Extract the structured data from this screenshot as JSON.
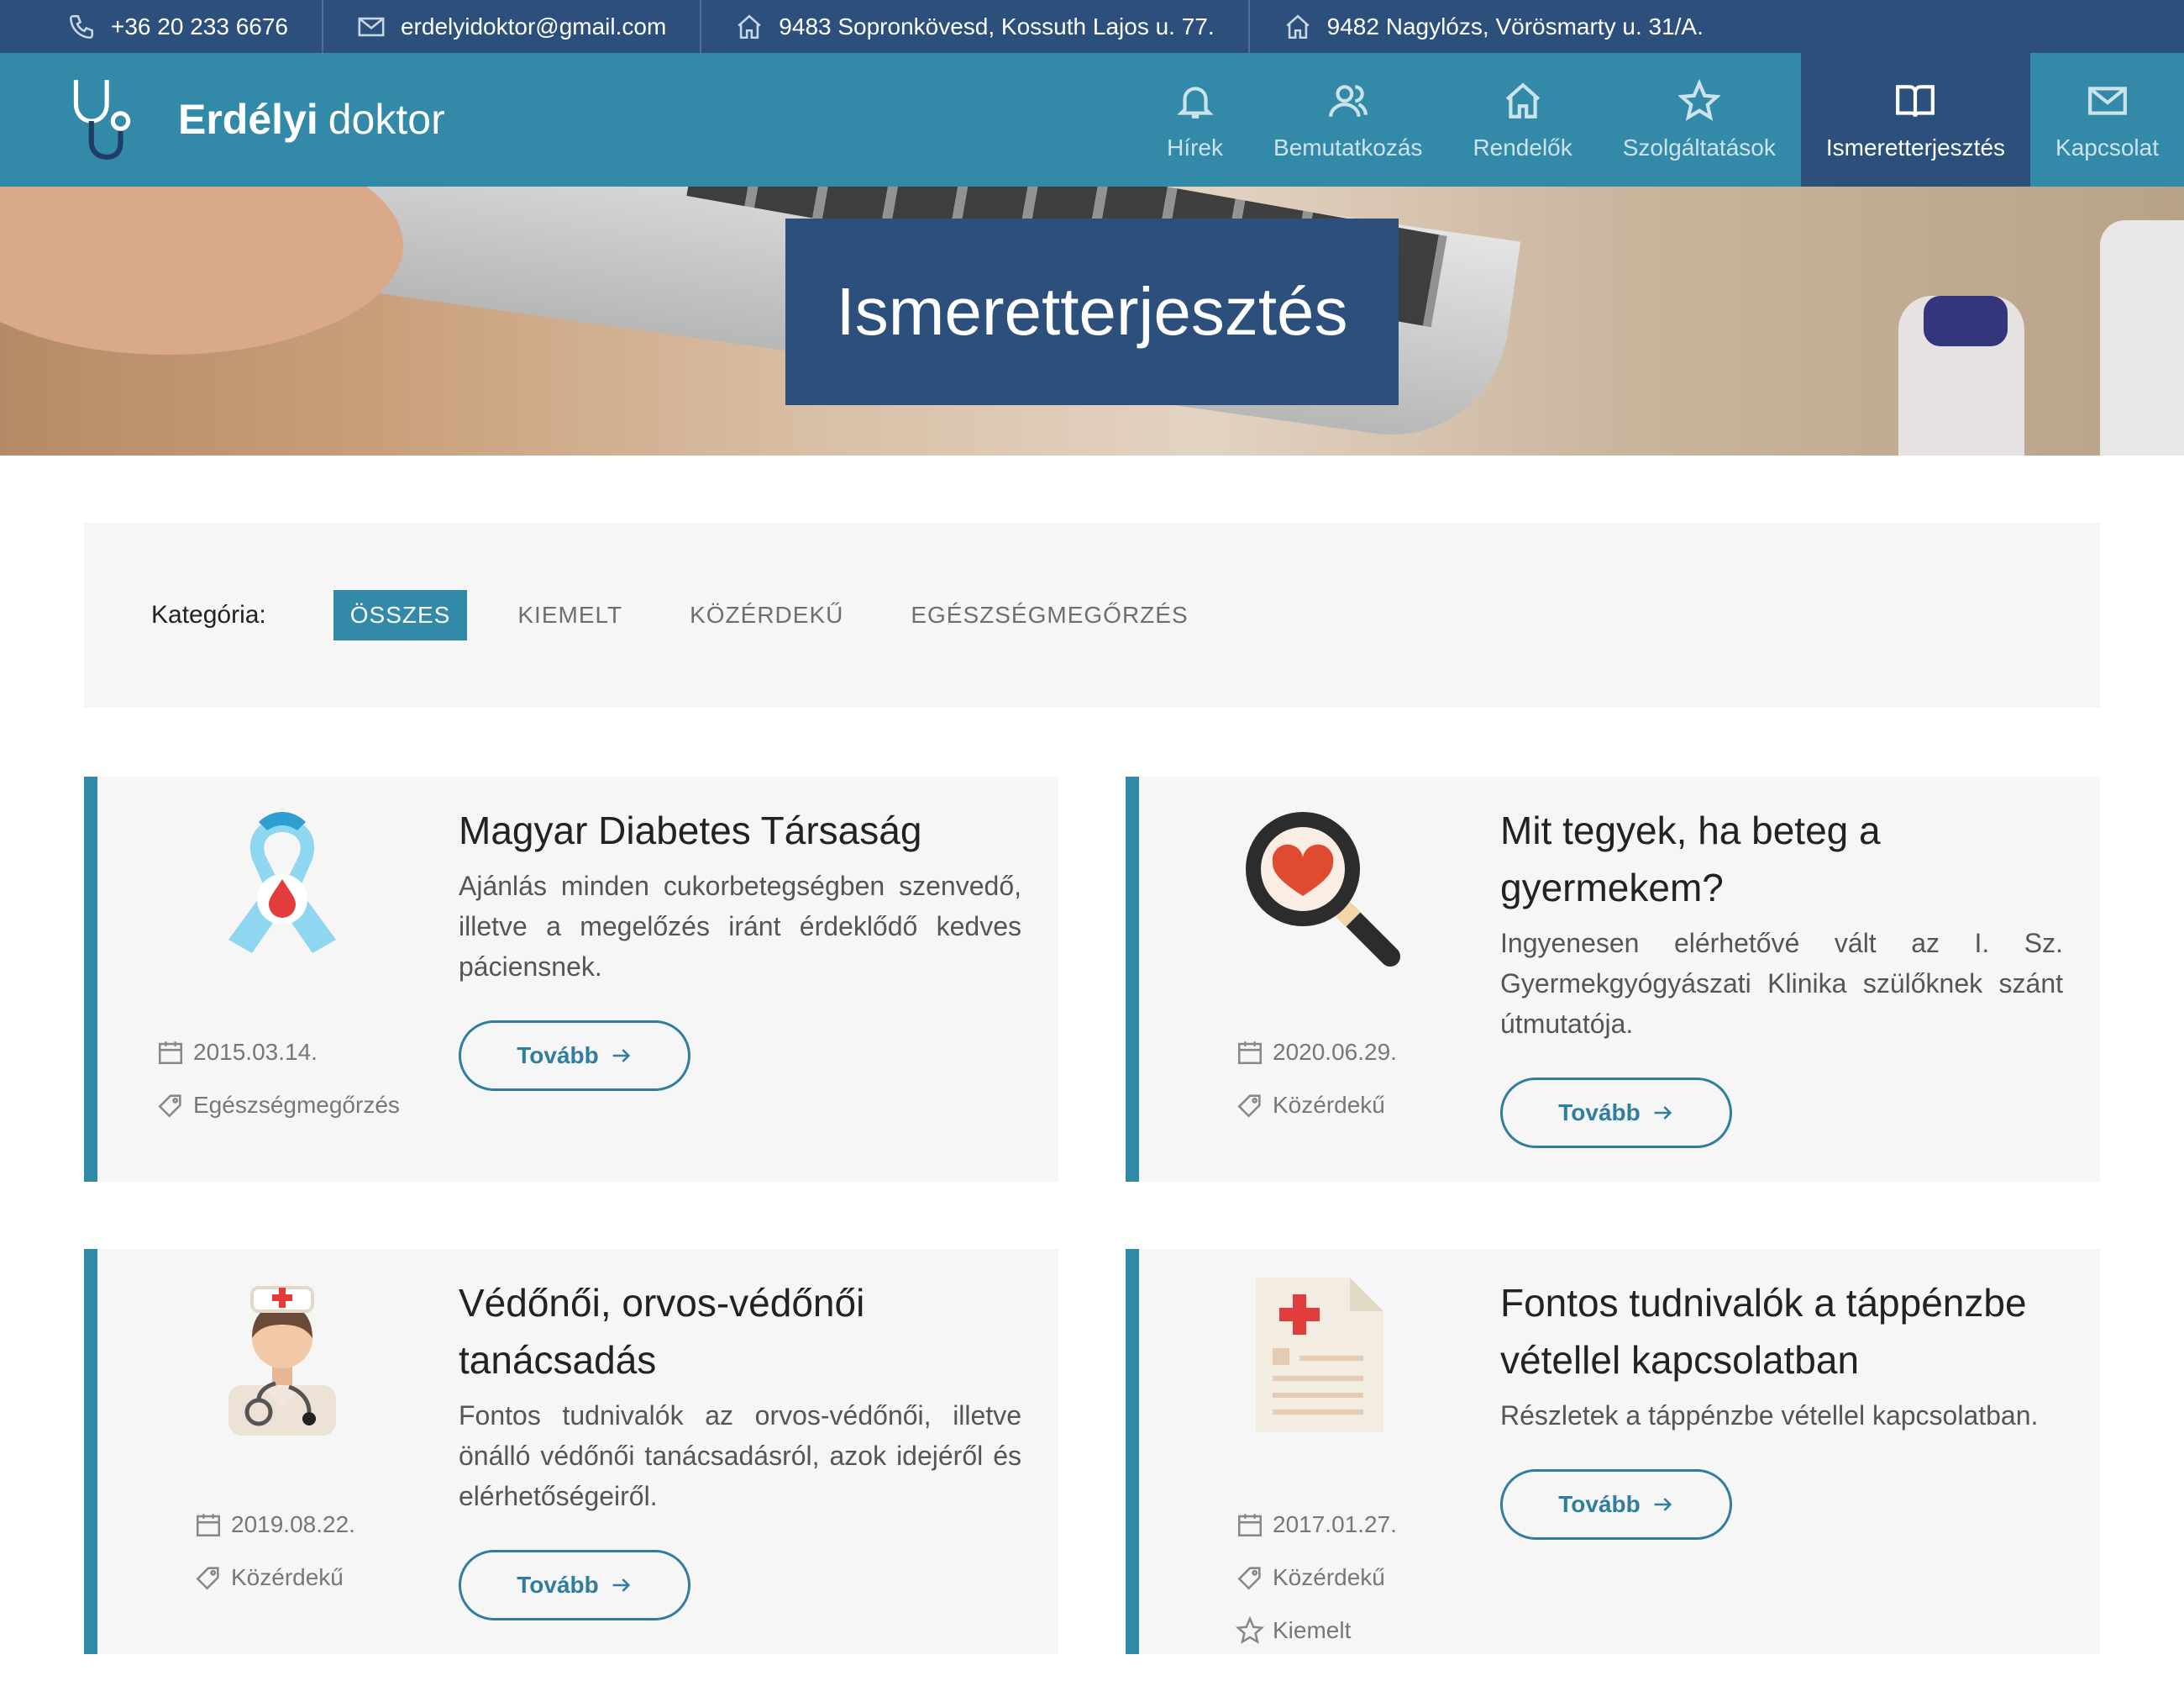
{
  "topbar": {
    "phone": "+36 20 233 6676",
    "email": "erdelyidoktor@gmail.com",
    "address1": "9483 Sopronkövesd, Kossuth Lajos u. 77.",
    "address2": "9482 Nagylózs, Vörösmarty u. 31/A."
  },
  "brand": {
    "bold": "Erdélyi",
    "light": "doktor"
  },
  "nav": {
    "items": [
      {
        "label": "Hírek",
        "icon": "bell-icon"
      },
      {
        "label": "Bemutatkozás",
        "icon": "users-icon"
      },
      {
        "label": "Rendelők",
        "icon": "home-icon"
      },
      {
        "label": "Szolgáltatások",
        "icon": "star-icon"
      },
      {
        "label": "Ismeretterjesztés",
        "icon": "book-icon",
        "active": true
      },
      {
        "label": "Kapcsolat",
        "icon": "mail-icon"
      }
    ]
  },
  "hero": {
    "title": "Ismeretterjesztés"
  },
  "filter": {
    "label": "Kategória:",
    "options": [
      "ÖSSZES",
      "KIEMELT",
      "KÖZÉRDEKŰ",
      "EGÉSZSÉGMEGŐRZÉS"
    ],
    "selected": "ÖSSZES"
  },
  "cards": [
    {
      "title": "Magyar Diabetes Társaság",
      "body": "Ajánlás minden cukorbetegségben szenvedő, illetve a megelőzés iránt érdeklődő kedves páciensnek.",
      "date": "2015.03.14.",
      "category": "Egészségmegőrzés",
      "button": "Tovább",
      "icon": "ribbon-icon"
    },
    {
      "title": "Mit tegyek, ha beteg a gyermekem?",
      "body": "Ingyenesen elérhetővé vált az I. Sz. Gyermekgyógyászati Klinika szülőknek szánt útmutatója.",
      "date": "2020.06.29.",
      "category": "Közérdekű",
      "button": "Tovább",
      "icon": "magnifier-heart-icon"
    },
    {
      "title": "Védőnői, orvos-védőnői tanácsadás",
      "body": "Fontos tudnivalók az orvos-védőnői, illetve önálló védőnői tanácsadásról, azok idejéről és elérhetőségeiről.",
      "date": "2019.08.22.",
      "category": "Közérdekű",
      "button": "Tovább",
      "icon": "nurse-icon"
    },
    {
      "title": "Fontos tudnivalók a táppénzbe vétellel kapcsolatban",
      "body": "Részletek a táppénzbe vétellel kapcsolatban.",
      "date": "2017.01.27.",
      "category": "Közérdekű",
      "featured": "Kiemelt",
      "button": "Tovább",
      "icon": "medical-document-icon"
    }
  ],
  "colors": {
    "navy": "#2c4f7c",
    "teal": "#3389a8",
    "cardBg": "#f6f6f6"
  }
}
